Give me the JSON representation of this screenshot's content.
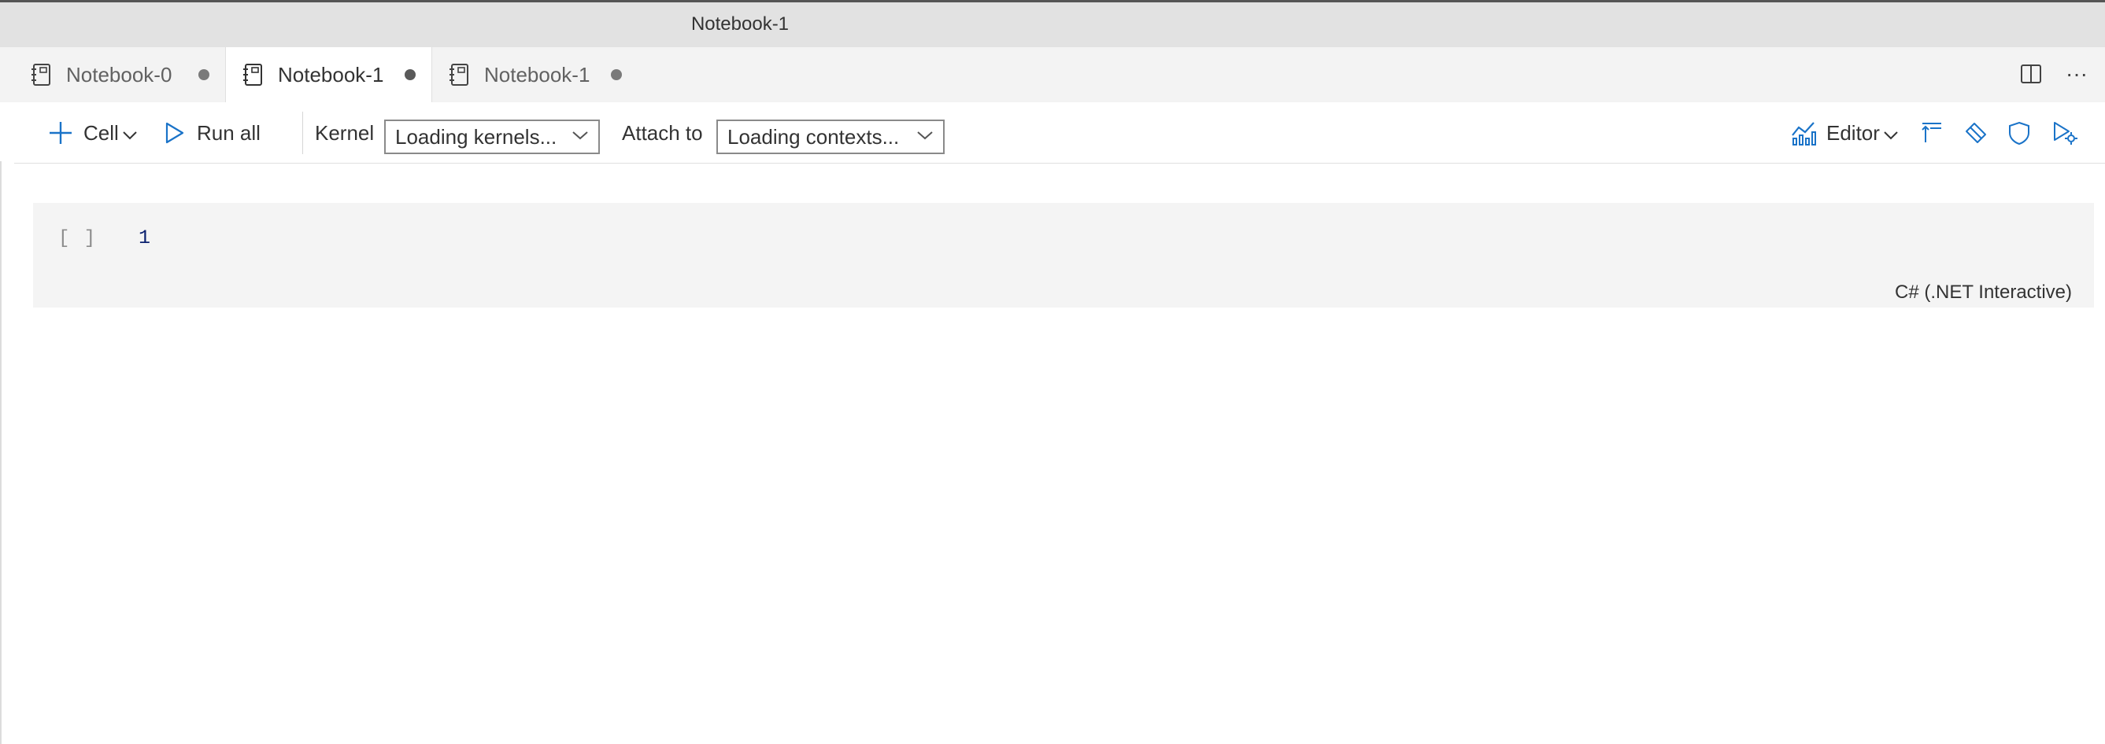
{
  "window": {
    "title": "Notebook-1"
  },
  "tabs": [
    {
      "label": "Notebook-0",
      "active": false,
      "dirty": true
    },
    {
      "label": "Notebook-1",
      "active": true,
      "dirty": true
    },
    {
      "label": "Notebook-1",
      "active": false,
      "dirty": true
    }
  ],
  "tabbar_actions": [
    {
      "icon": "split-editor-icon"
    },
    {
      "icon": "more-actions-icon",
      "glyph": "···"
    }
  ],
  "toolbar": {
    "add_cell_label": "Cell",
    "run_all_label": "Run all",
    "kernel_label": "Kernel",
    "kernel_value": "Loading kernels...",
    "attach_label": "Attach to",
    "attach_value": "Loading contexts...",
    "view_label": "Editor"
  },
  "cell": {
    "exec_count": "[ ]",
    "line_number": "1",
    "language": "C# (.NET Interactive)"
  },
  "colors": {
    "accent": "#1a73c8",
    "titlebar_bg": "#e2e2e2",
    "tabbar_bg": "#f3f3f3",
    "cell_bg": "#f4f4f4"
  }
}
